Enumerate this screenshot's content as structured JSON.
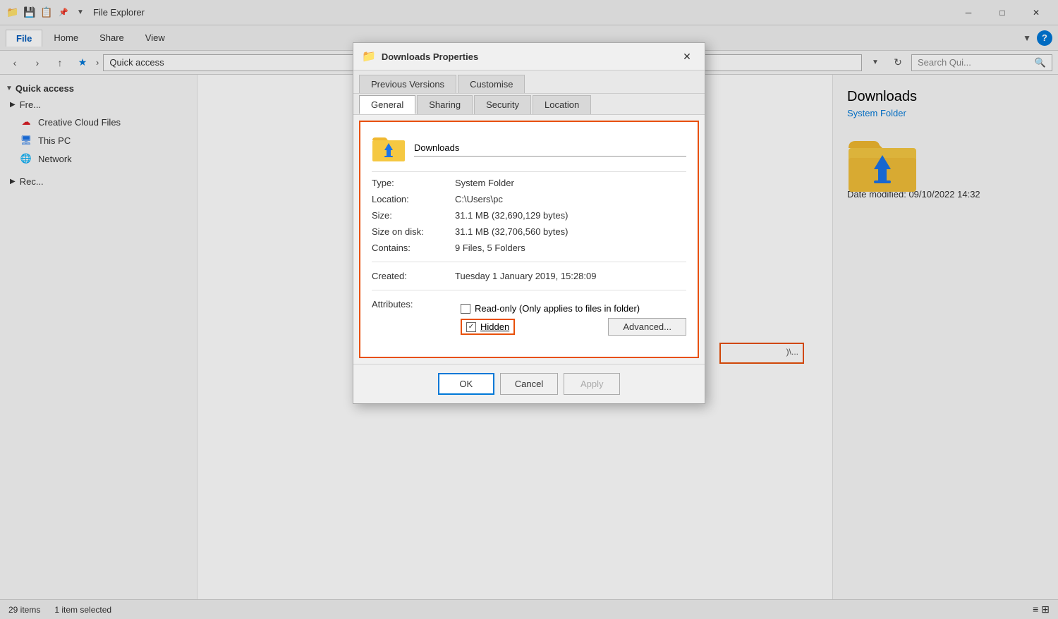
{
  "titleBar": {
    "title": "File Explorer",
    "icons": [
      "📁",
      "💾",
      "📋"
    ],
    "controls": [
      "—",
      "□",
      "✕"
    ]
  },
  "ribbon": {
    "tabs": [
      "File",
      "Home",
      "Share",
      "View"
    ],
    "activeTab": "File",
    "searchPlaceholder": "Search Qui...",
    "helpIcon": "?"
  },
  "addressBar": {
    "backDisabled": false,
    "forwardDisabled": false,
    "upEnabled": true,
    "starEnabled": true,
    "path": "Quick access",
    "searchPlaceholder": "Search Quic..."
  },
  "sidebar": {
    "sections": [
      {
        "name": "Quick access",
        "expanded": true,
        "items": []
      }
    ],
    "items": [
      {
        "id": "quick-access",
        "label": "Quick access",
        "icon": "⭐",
        "active": true,
        "indent": false
      },
      {
        "id": "creative-cloud",
        "label": "Creative Cloud Files",
        "icon": "☁",
        "active": false,
        "indent": true
      },
      {
        "id": "this-pc",
        "label": "This PC",
        "icon": "💻",
        "active": false,
        "indent": false
      },
      {
        "id": "network",
        "label": "Network",
        "icon": "🌐",
        "active": false,
        "indent": false
      }
    ]
  },
  "previewPanel": {
    "title": "Downloads",
    "subtitle": "System Folder",
    "dateModifiedLabel": "Date modified:",
    "dateModifiedValue": "09/10/2022 14:32"
  },
  "statusBar": {
    "itemCount": "29 items",
    "selectedCount": "1 item selected"
  },
  "dialog": {
    "title": "Downloads Properties",
    "tabs": {
      "topRow": [
        "Previous Versions",
        "Customise"
      ],
      "bottomRow": [
        "General",
        "Sharing",
        "Security",
        "Location"
      ],
      "activeTab": "General"
    },
    "folderName": "Downloads",
    "properties": {
      "typeLabel": "Type:",
      "typeValue": "System Folder",
      "locationLabel": "Location:",
      "locationValue": "C:\\Users\\pc",
      "sizeLabel": "Size:",
      "sizeValue": "31.1 MB (32,690,129 bytes)",
      "sizeOnDiskLabel": "Size on disk:",
      "sizeOnDiskValue": "31.1 MB (32,706,560 bytes)",
      "containsLabel": "Contains:",
      "containsValue": "9 Files, 5 Folders",
      "createdLabel": "Created:",
      "createdValue": "Tuesday 1 January 2019, 15:28:09",
      "attributesLabel": "Attributes:"
    },
    "attributes": {
      "readonlyLabel": "Read-only (Only applies to files in folder)",
      "readonlyChecked": false,
      "hiddenLabel": "Hidden",
      "hiddenChecked": true,
      "advancedButtonLabel": "Advanced..."
    },
    "footer": {
      "okLabel": "OK",
      "cancelLabel": "Cancel",
      "applyLabel": "Apply"
    }
  }
}
